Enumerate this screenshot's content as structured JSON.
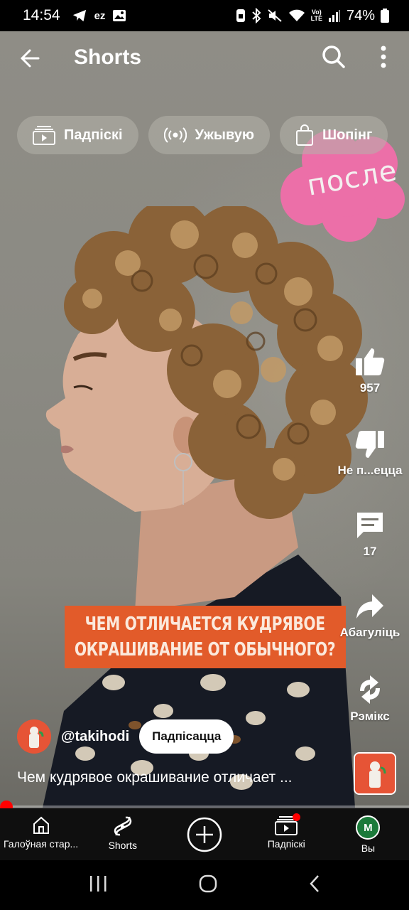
{
  "status_bar": {
    "time": "14:54",
    "battery": "74%"
  },
  "header": {
    "title": "Shorts"
  },
  "chips": [
    {
      "label": "Падпіскі",
      "icon": "subscriptions-icon"
    },
    {
      "label": "Ужывую",
      "icon": "live-icon"
    },
    {
      "label": "Шопінг",
      "icon": "shopping-bag-icon"
    }
  ],
  "video": {
    "sticker_text": "после",
    "banner_line1": "ЧЕМ ОТЛИЧАЕТСЯ КУДРЯВОЕ",
    "banner_line2": "ОКРАШИВАНИЕ ОТ ОБЫЧНОГО?",
    "accent": "#e25b2a",
    "sticker_color": "#ec6fa8"
  },
  "actions": {
    "like_count": "957",
    "dislike_label": "Не п...ецца",
    "comments_count": "17",
    "share_label": "Абагуліць",
    "remix_label": "Рэмікс"
  },
  "channel": {
    "handle": "@takihodi",
    "subscribe_label": "Падпісацца",
    "caption": "Чем кудрявое окрашивание отличает ..."
  },
  "progress": {
    "fraction": 0.0
  },
  "bottom_nav": {
    "home": "Галоўная стар...",
    "shorts": "Shorts",
    "subs": "Падпіскі",
    "you": "Вы",
    "you_initial": "M"
  }
}
